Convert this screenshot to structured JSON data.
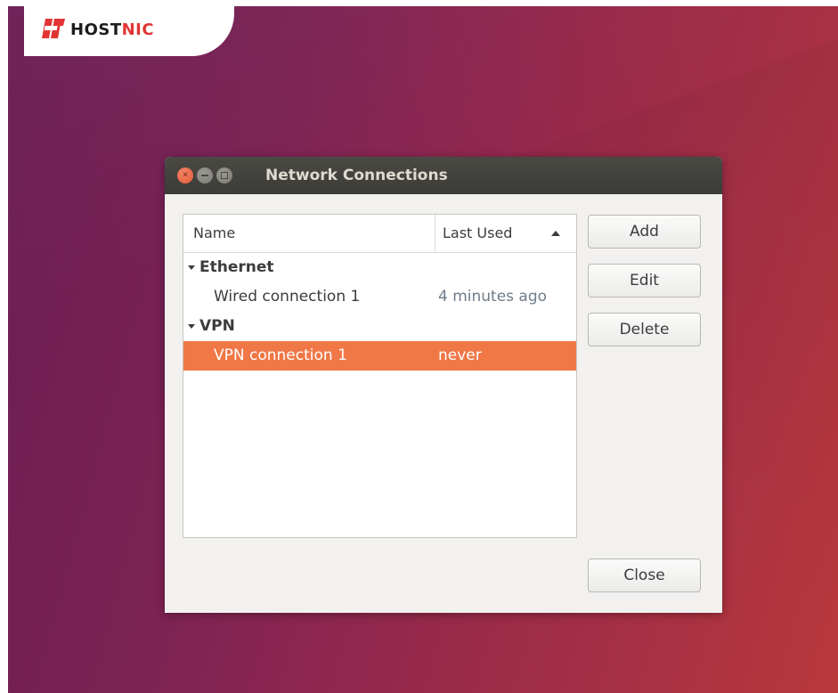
{
  "brand": {
    "logo_text_main": "HOST",
    "logo_text_accent": "NIC",
    "logo_icon": "hostnic-logo-icon",
    "accent_color": "#e23434"
  },
  "window": {
    "title": "Network Connections",
    "controls": {
      "close_icon": "close-icon",
      "minimize_icon": "minimize-icon",
      "maximize_icon": "maximize-icon"
    }
  },
  "list": {
    "columns": {
      "name": "Name",
      "last_used": "Last Used",
      "sort_icon": "sort-ascending-icon"
    },
    "groups": [
      {
        "label": "Ethernet",
        "connections": [
          {
            "name": "Wired connection 1",
            "last_used": "4 minutes ago",
            "selected": false
          }
        ]
      },
      {
        "label": "VPN",
        "connections": [
          {
            "name": "VPN connection 1",
            "last_used": "never",
            "selected": true
          }
        ]
      }
    ],
    "selection_color": "#f07746"
  },
  "buttons": {
    "add": "Add",
    "edit": "Edit",
    "delete": "Delete",
    "close": "Close"
  }
}
